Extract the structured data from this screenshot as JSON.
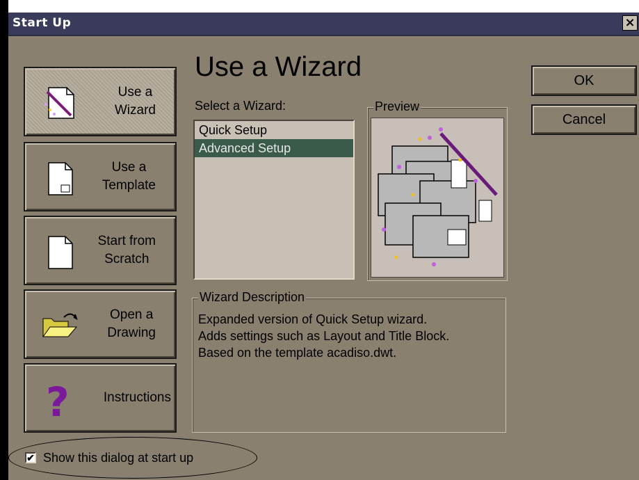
{
  "window": {
    "title": "Start Up",
    "close_glyph": "×"
  },
  "nav": [
    {
      "label": "Use a\nWizard",
      "icon": "wizard-wand-icon"
    },
    {
      "label": "Use a\nTemplate",
      "icon": "template-document-icon"
    },
    {
      "label": "Start from\nScratch",
      "icon": "blank-document-icon"
    },
    {
      "label": "Open a\nDrawing",
      "icon": "open-folder-icon"
    },
    {
      "label": "Instructions",
      "icon": "question-mark-icon"
    }
  ],
  "main": {
    "heading": "Use a Wizard",
    "select_label": "Select a Wizard:",
    "wizards": [
      "Quick Setup",
      "Advanced Setup"
    ],
    "selected_wizard": "Advanced Setup",
    "preview_title": "Preview",
    "description_title": "Wizard Description",
    "description_lines": [
      "Expanded version of Quick Setup wizard.",
      "Adds settings such as Layout and Title Block.",
      "Based on the template acadiso.dwt."
    ]
  },
  "buttons": {
    "ok": "OK",
    "cancel": "Cancel"
  },
  "footer": {
    "show_dialog_label": "Show this dialog at start up",
    "show_dialog_checked": true,
    "check_glyph": "✔"
  }
}
